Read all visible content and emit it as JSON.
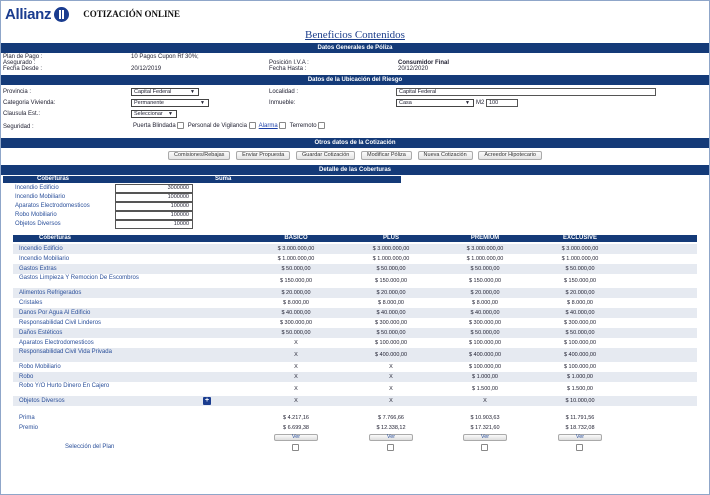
{
  "header": {
    "logo": "Allianz",
    "app_title": "COTIZACIÓN ONLINE"
  },
  "page_title": "Beneficios Contenidos",
  "sections": {
    "general": "Datos Generales de Póliza",
    "ubicacion": "Datos de la Ubicación del Riesgo",
    "otros": "Otros datos de la Cotización",
    "detalle": "Detalle de las Coberturas"
  },
  "general": {
    "plan_label": "Plan de Pago :",
    "plan_value": "10 Pagos Cupon Rf 30%;",
    "asegurado_label": "Asegurado :",
    "fecha_desde_label": "Fecha Desde :",
    "fecha_desde_value": "20/12/2019",
    "posicion_label": "Posición I.V.A :",
    "posicion_value": "Consumidor Final",
    "fecha_hasta_label": "Fecha Hasta :",
    "fecha_hasta_value": "20/12/2020"
  },
  "ubicacion": {
    "provincia_label": "Provincia :",
    "provincia_value": "Capital Federal",
    "localidad_label": "Localidad :",
    "localidad_value": "Capital Federal",
    "categoria_label": "Categoria Vivienda:",
    "categoria_value": "Permanente",
    "inmueble_label": "Inmueble:",
    "inmueble_value": "Casa",
    "m2_label": "M2",
    "m2_value": "100",
    "clausula_label": "Clausula Est.:",
    "clausula_value": "Seleccionar",
    "seguridad_label": "Seguridad :",
    "seg_puerta": "Puerta Blindada",
    "seg_personal": "Personal de Vigilancia",
    "seg_alarma": "Alarma",
    "seg_terremoto": "Terremoto"
  },
  "buttons": [
    "Comisiones/Rebajas",
    "Enviar Propuesta",
    "Guardar Cotización",
    "Modificar Póliza",
    "Nueva Cotización",
    "Acreedor Hipotecario"
  ],
  "suma": {
    "head_coberturas": "Coberturas",
    "head_suma": "Suma",
    "rows": [
      {
        "name": "Incendio Edificio",
        "value": "3000000"
      },
      {
        "name": "Incendio Mobiliario",
        "value": "1000000"
      },
      {
        "name": "Aparatos Electrodomesticos",
        "value": "100000"
      },
      {
        "name": "Robo Mobiliario",
        "value": "100000"
      },
      {
        "name": "Objetos Diversos",
        "value": "10000"
      }
    ]
  },
  "plans": {
    "headers": [
      "Coberturas",
      "BASICO",
      "PLUS",
      "PREMIUM",
      "EXCLUSIVE"
    ],
    "rows": [
      {
        "name": "Incendio Edificio",
        "values": [
          "$ 3.000.000,00",
          "$ 3.000.000,00",
          "$ 3.000.000,00",
          "$ 3.000.000,00"
        ]
      },
      {
        "name": "Incendio Mobiliario",
        "values": [
          "$ 1.000.000,00",
          "$ 1.000.000,00",
          "$ 1.000.000,00",
          "$ 1.000.000,00"
        ]
      },
      {
        "name": "Gastos Extras",
        "values": [
          "$ 50.000,00",
          "$ 50.000,00",
          "$ 50.000,00",
          "$ 50.000,00"
        ]
      },
      {
        "name": "Gastos Limpieza Y Remocion De Escombros",
        "values": [
          "$ 150.000,00",
          "$ 150.000,00",
          "$ 150.000,00",
          "$ 150.000,00"
        ]
      },
      {
        "name": "Alimentos Refrigerados",
        "values": [
          "$ 20.000,00",
          "$ 20.000,00",
          "$ 20.000,00",
          "$ 20.000,00"
        ]
      },
      {
        "name": "Cristales",
        "values": [
          "$ 8.000,00",
          "$ 8.000,00",
          "$ 8.000,00",
          "$ 8.000,00"
        ]
      },
      {
        "name": "Danos Por Agua Al Edificio",
        "values": [
          "$ 40.000,00",
          "$ 40.000,00",
          "$ 40.000,00",
          "$ 40.000,00"
        ]
      },
      {
        "name": "Responsabilidad Civil Linderos",
        "values": [
          "$ 300.000,00",
          "$ 300.000,00",
          "$ 300.000,00",
          "$ 300.000,00"
        ]
      },
      {
        "name": "Daños Estéticos",
        "values": [
          "$ 50.000,00",
          "$ 50.000,00",
          "$ 50.000,00",
          "$ 50.000,00"
        ]
      },
      {
        "name": "Aparatos Electrodomesticos",
        "values": [
          "X",
          "$ 100.000,00",
          "$ 100.000,00",
          "$ 100.000,00"
        ]
      },
      {
        "name": "Responsabilidad Civil Vida Privada",
        "values": [
          "X",
          "$ 400.000,00",
          "$ 400.000,00",
          "$ 400.000,00"
        ]
      },
      {
        "name": "Robo Mobiliario",
        "values": [
          "X",
          "X",
          "$ 100.000,00",
          "$ 100.000,00"
        ]
      },
      {
        "name": "Robo",
        "values": [
          "X",
          "X",
          "$ 1.000,00",
          "$ 1.000,00"
        ]
      },
      {
        "name": "Robo Y/O Hurto Dinero En Cajero",
        "values": [
          "X",
          "X",
          "$ 1.500,00",
          "$ 1.500,00"
        ]
      },
      {
        "name": "Objetos Diversos",
        "values": [
          "X",
          "X",
          "X",
          "$ 10.000,00"
        ]
      }
    ],
    "prima_label": "Prima",
    "prima": [
      "$ 4.217,16",
      "$ 7.766,66",
      "$ 10.903,63",
      "$ 11.791,56"
    ],
    "premio_label": "Premio",
    "premio": [
      "$ 6.699,38",
      "$ 12.338,12",
      "$ 17.321,60",
      "$ 18.732,08"
    ],
    "ver_label": "Ver",
    "seleccion_label": "Selección del Plan"
  },
  "colors": {
    "header_bar": "#143a78",
    "brand": "#1a3c8f",
    "row_shade": "#e6eaf1"
  }
}
